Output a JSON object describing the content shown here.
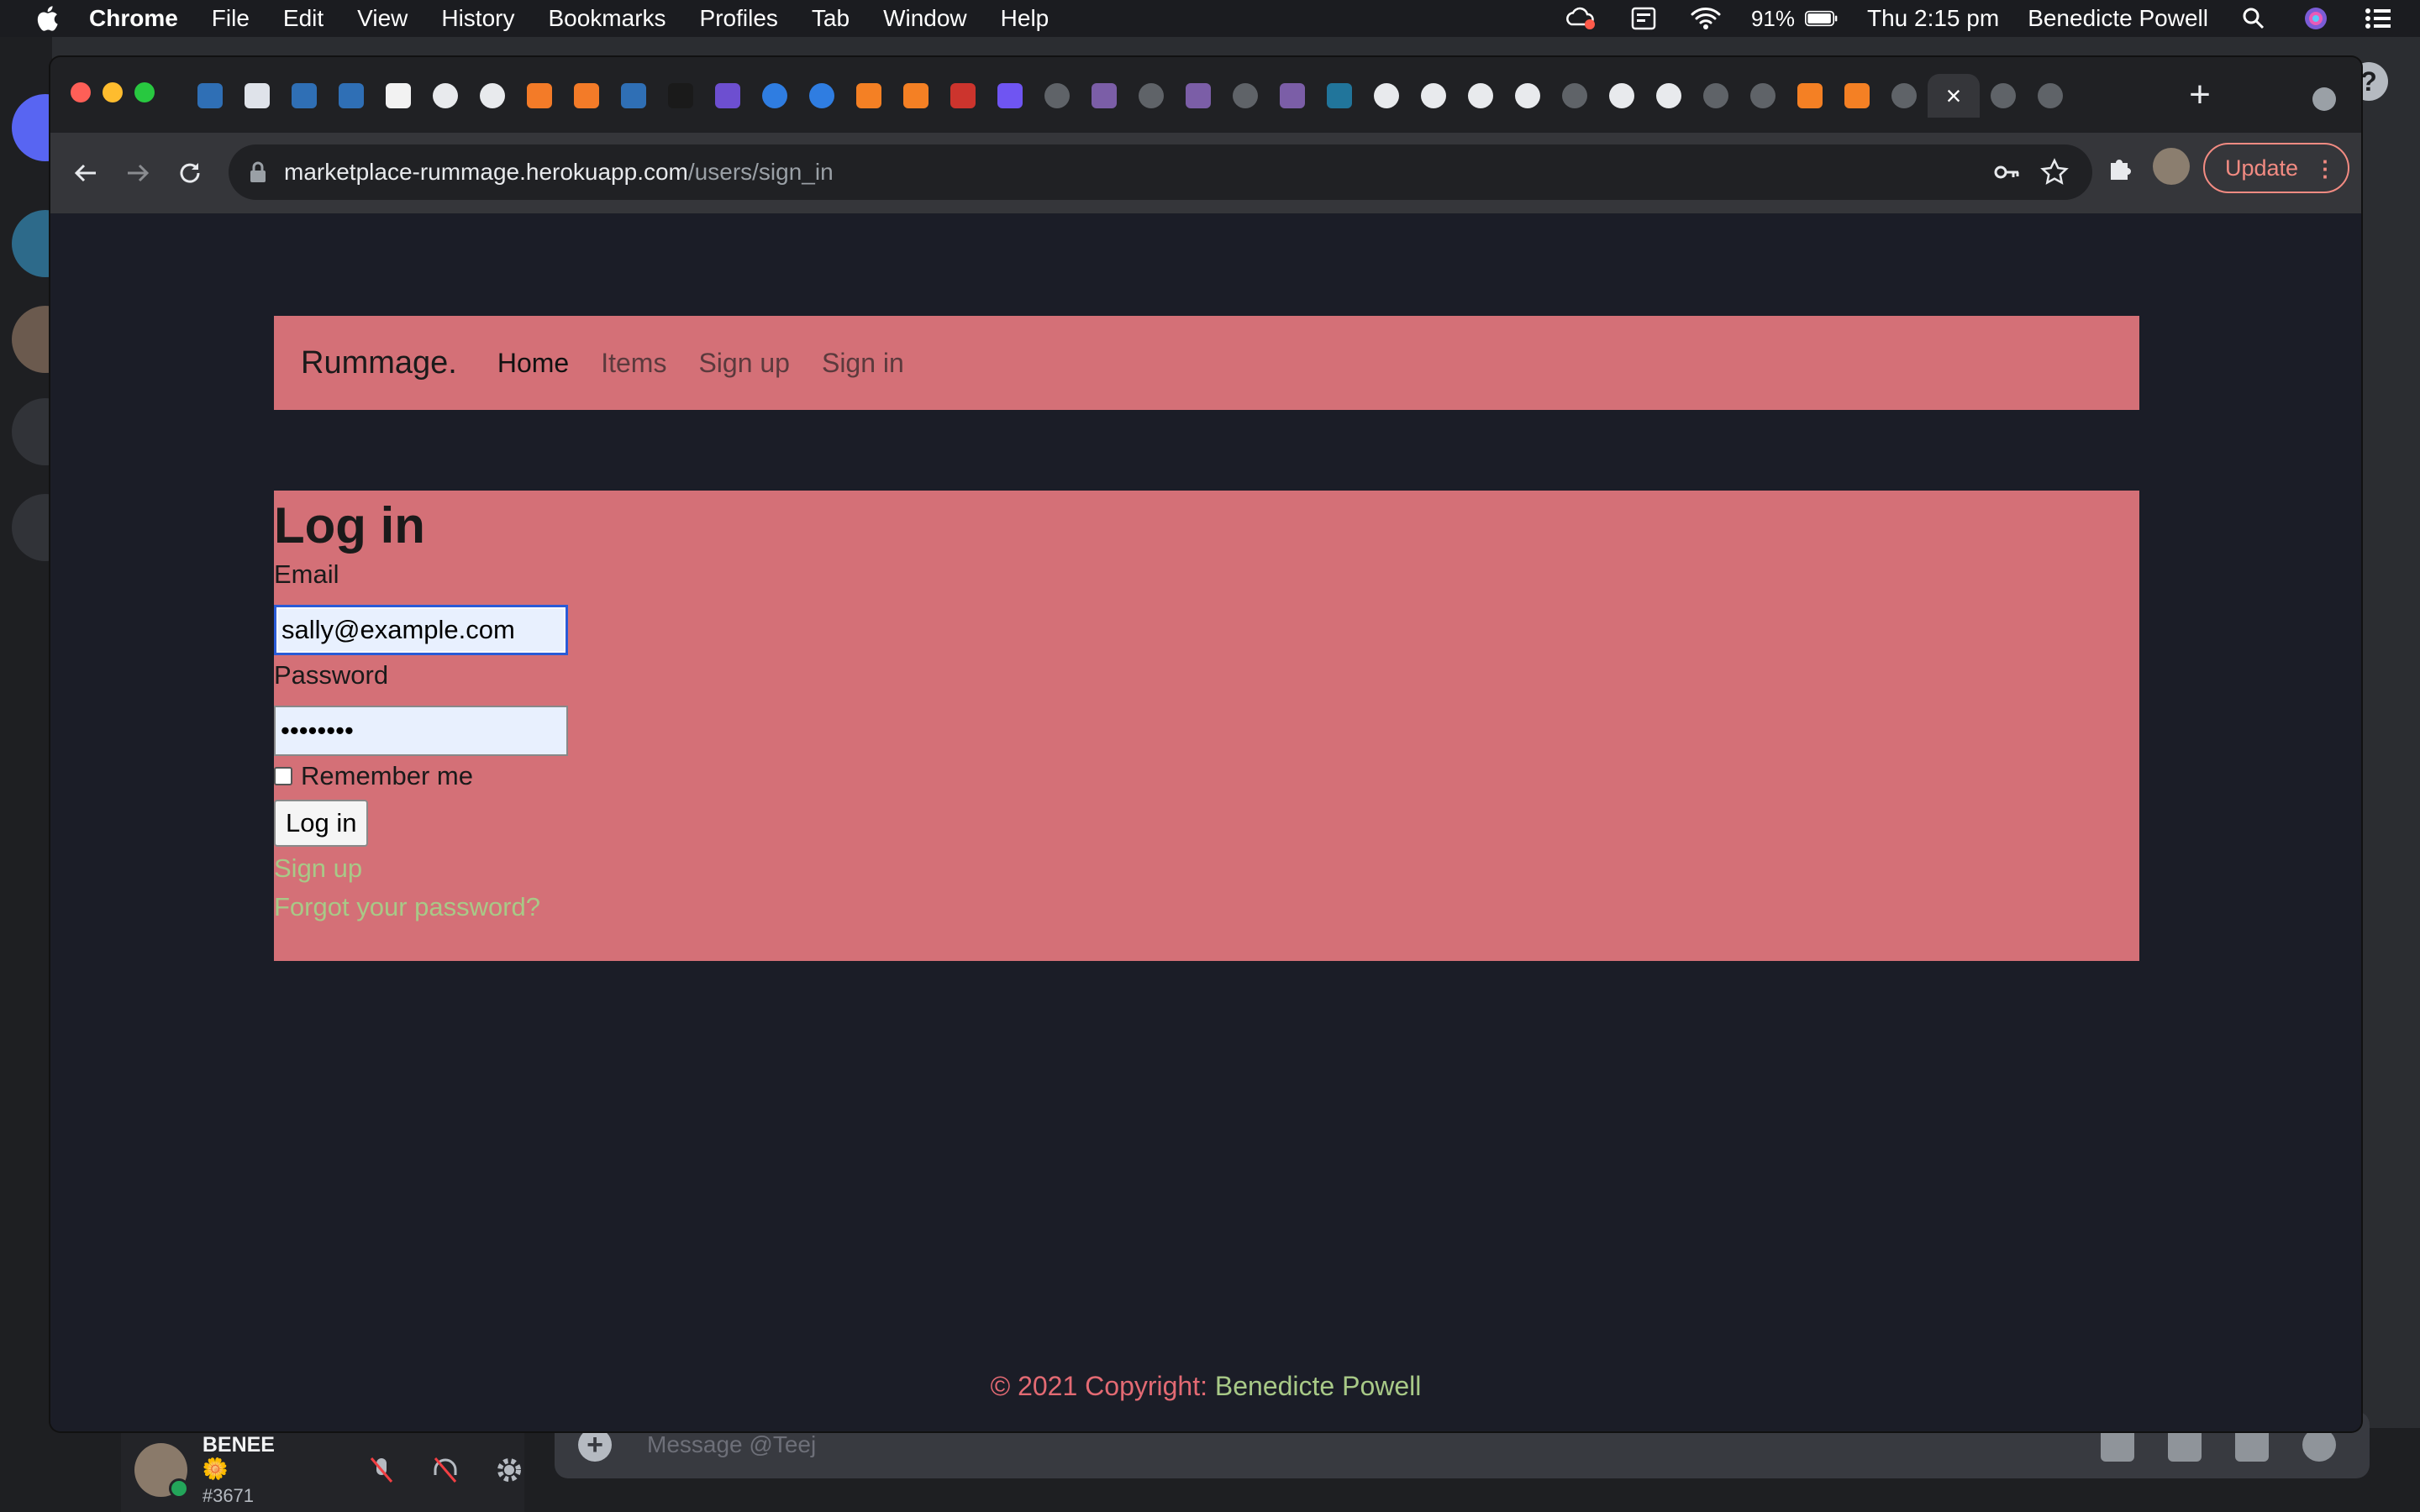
{
  "menubar": {
    "app": "Chrome",
    "items": [
      "File",
      "Edit",
      "View",
      "History",
      "Bookmarks",
      "Profiles",
      "Tab",
      "Window",
      "Help"
    ],
    "battery": "91%",
    "datetime": "Thu 2:15 pm",
    "user": "Benedicte Powell"
  },
  "chrome": {
    "address_host": "marketplace-rummage.herokuapp.com",
    "address_path": "/users/sign_in",
    "update_label": "Update"
  },
  "site": {
    "brand": "Rummage.",
    "nav": [
      "Home",
      "Items",
      "Sign up",
      "Sign in"
    ],
    "heading": "Log in",
    "email_label": "Email",
    "email_value": "sally@example.com",
    "password_label": "Password",
    "password_value": "••••••••",
    "remember_label": "Remember me",
    "submit_label": "Log in",
    "signup_link": "Sign up",
    "forgot_link": "Forgot your password?",
    "footer_prefix": "© 2021 Copyright: ",
    "footer_owner": "Benedicte Powell",
    "colors": {
      "panel": "#d47077",
      "link": "#a8c987",
      "page_bg": "#1b1d27"
    }
  },
  "discord": {
    "username": "BENEE🌼",
    "tag": "#3671",
    "message_placeholder": "Message @Teej"
  }
}
